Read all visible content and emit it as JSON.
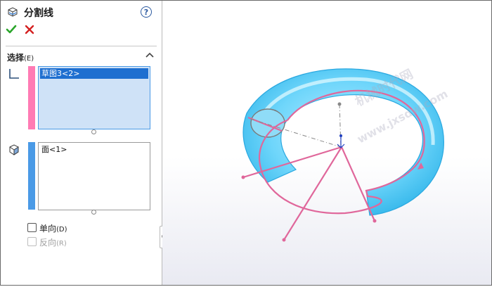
{
  "panel": {
    "title": "分割线",
    "help": "?",
    "section_title": "选择",
    "section_accel": "(E)",
    "list1": {
      "items": [
        "草图3<2>"
      ]
    },
    "list2": {
      "items": [
        "面<1>"
      ]
    },
    "checkbox_single": {
      "label": "单向",
      "accel": "(D)",
      "checked": false
    },
    "checkbox_reverse": {
      "label": "反向",
      "accel": "(R)",
      "checked": false,
      "disabled": true
    }
  },
  "viewport": {
    "watermark_line1": "机械时代网",
    "watermark_line2": "www.jxsdw.com"
  },
  "colors": {
    "accent": "#1e6fd0",
    "pink_selector": "#ff7bb4",
    "blue_selector": "#4a9ae6",
    "torus": "#5fd0f7",
    "sketch": "#e0679b"
  }
}
